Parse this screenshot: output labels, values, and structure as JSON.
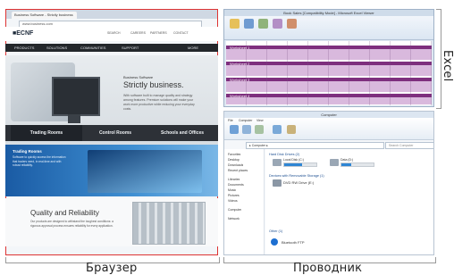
{
  "captions": {
    "browser": "Браузер",
    "explorer": "Проводник",
    "excel": "Excel"
  },
  "browser": {
    "tab_title": "Business Software - Strictly business",
    "address": "www.business.com",
    "bookmark": "Bookmarks",
    "logo": "■ECNF",
    "topnav": [
      "SEARCH",
      "CAREERS",
      "PARTNERS",
      "CONTACT"
    ],
    "navitems": [
      "PRODUCTS",
      "SOLUTIONS",
      "COMMUNITIES",
      "SUPPORT",
      "MORE"
    ],
    "hero": {
      "kicker": "Business Software",
      "title": "Strictly business.",
      "text": "With software built to manage quality and strategy among features. Premium solutions will make your work more productive while reducing your everyday costs."
    },
    "tabs": [
      "Trading Rooms",
      "Control Rooms",
      "Schools and Offices"
    ],
    "promo": {
      "title": "Trading Rooms",
      "text": "Software to quickly access the information that traders need, in real-time and with robust reliability."
    },
    "quality": {
      "title": "Quality and Reliability",
      "text": "Our products are designed to withstand the toughest conditions: a rigorous approval process ensures reliability for every application."
    }
  },
  "excel": {
    "title": "Book Sales [Compatibility Mode] - Microsoft Excel Viewer",
    "rows": [
      "Worksheet 1",
      "Worksheet 2",
      "Worksheet 3",
      "Worksheet 4"
    ]
  },
  "explorer": {
    "title": "Computer",
    "tabs": [
      "File",
      "Computer",
      "View"
    ],
    "address": "▸ Computer ▸",
    "search": "Search Computer",
    "nav": [
      "Favorites",
      "Desktop",
      "Downloads",
      "Recent places",
      "Libraries",
      "Documents",
      "Music",
      "Pictures",
      "Videos",
      "Computer",
      "Network"
    ],
    "sections": [
      "Hard Disk Drives (2)",
      "Devices with Removable Storage (1)",
      "Other (1)"
    ],
    "drives": [
      {
        "name": "Local Disk (C:)",
        "used": 0.55
      },
      {
        "name": "Data (D:)",
        "used": 0.3
      }
    ],
    "removable": "DVD RW Drive (E:)",
    "other": "Bluetooth FTP"
  }
}
